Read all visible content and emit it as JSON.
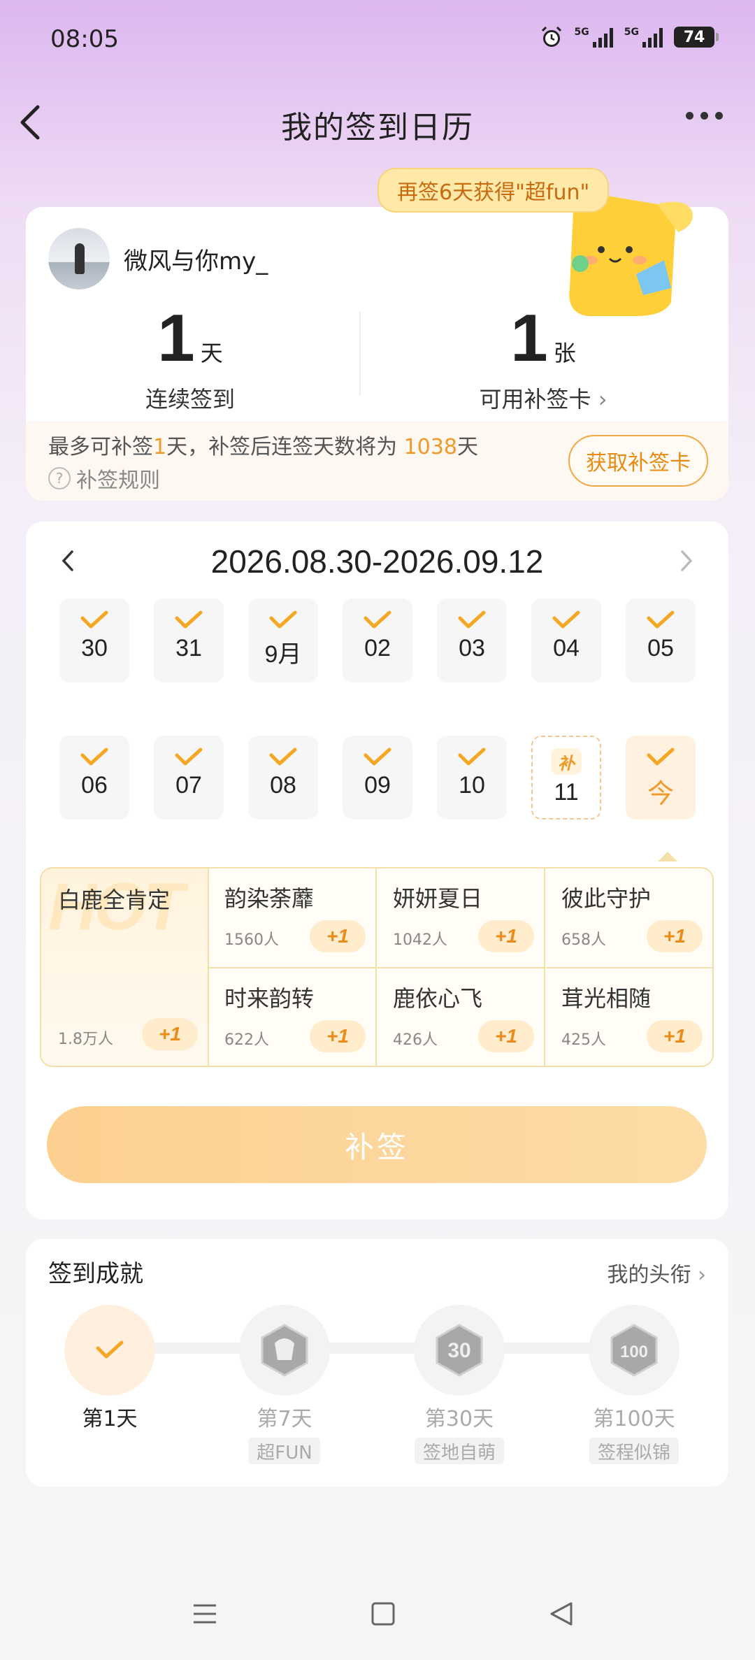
{
  "status_bar": {
    "time": "08:05",
    "battery": "74",
    "network_1": "5G",
    "network_2": "5G",
    "icons": [
      "alarm-icon",
      "signal-icon",
      "signal-icon",
      "battery-icon"
    ]
  },
  "header": {
    "title": "我的签到日历",
    "back_icon": "chevron-left-icon",
    "more_icon": "more-dots-icon"
  },
  "bubble": {
    "text": "再签6天获得\"超fun\""
  },
  "profile": {
    "username": "微风与你my_",
    "streak_value": "1",
    "streak_unit": "天",
    "streak_label": "连续签到",
    "cards_value": "1",
    "cards_unit": "张",
    "cards_label": "可用补签卡",
    "makeup_prefix": "最多可补签",
    "makeup_days": "1",
    "makeup_mid": "天，补签后连签天数将为",
    "makeup_total": "1038",
    "makeup_suffix": "天",
    "rules_label": "补签规则",
    "get_card_button": "获取补签卡"
  },
  "calendar": {
    "range": "2026.08.30-2026.09.12",
    "week1": [
      {
        "label": "30",
        "state": "checked"
      },
      {
        "label": "31",
        "state": "checked"
      },
      {
        "label": "9月",
        "state": "checked"
      },
      {
        "label": "02",
        "state": "checked"
      },
      {
        "label": "03",
        "state": "checked"
      },
      {
        "label": "04",
        "state": "checked"
      },
      {
        "label": "05",
        "state": "checked"
      }
    ],
    "week2": [
      {
        "label": "06",
        "state": "checked"
      },
      {
        "label": "07",
        "state": "checked"
      },
      {
        "label": "08",
        "state": "checked"
      },
      {
        "label": "09",
        "state": "checked"
      },
      {
        "label": "10",
        "state": "checked"
      },
      {
        "label": "11",
        "state": "makeup",
        "badge": "补"
      },
      {
        "label": "今",
        "state": "today"
      }
    ]
  },
  "topics": {
    "hot_watermark": "HOT",
    "hot": {
      "name": "白鹿全肯定",
      "count": "1.8万人",
      "plus": "+1"
    },
    "items": [
      {
        "name": "韵染荼蘼",
        "count": "1560人",
        "plus": "+1"
      },
      {
        "name": "妍妍夏日",
        "count": "1042人",
        "plus": "+1"
      },
      {
        "name": "彼此守护",
        "count": "658人",
        "plus": "+1"
      },
      {
        "name": "时来韵转",
        "count": "622人",
        "plus": "+1"
      },
      {
        "name": "鹿依心飞",
        "count": "426人",
        "plus": "+1"
      },
      {
        "name": "茸光相随",
        "count": "425人",
        "plus": "+1"
      }
    ]
  },
  "makeup_button": "补签",
  "achievements": {
    "title": "签到成就",
    "link": "我的头衔",
    "nodes": [
      {
        "label": "第1天",
        "sub": "",
        "done": true
      },
      {
        "label": "第7天",
        "sub": "超FUN",
        "done": false
      },
      {
        "label": "第30天",
        "sub": "签地自萌",
        "done": false,
        "badge_text": "30"
      },
      {
        "label": "第100天",
        "sub": "签程似锦",
        "done": false,
        "badge_text": "100"
      }
    ]
  },
  "colors": {
    "accent": "#f29a28",
    "check": "#f5a623",
    "bubble_bg": "#ffe9a8"
  }
}
